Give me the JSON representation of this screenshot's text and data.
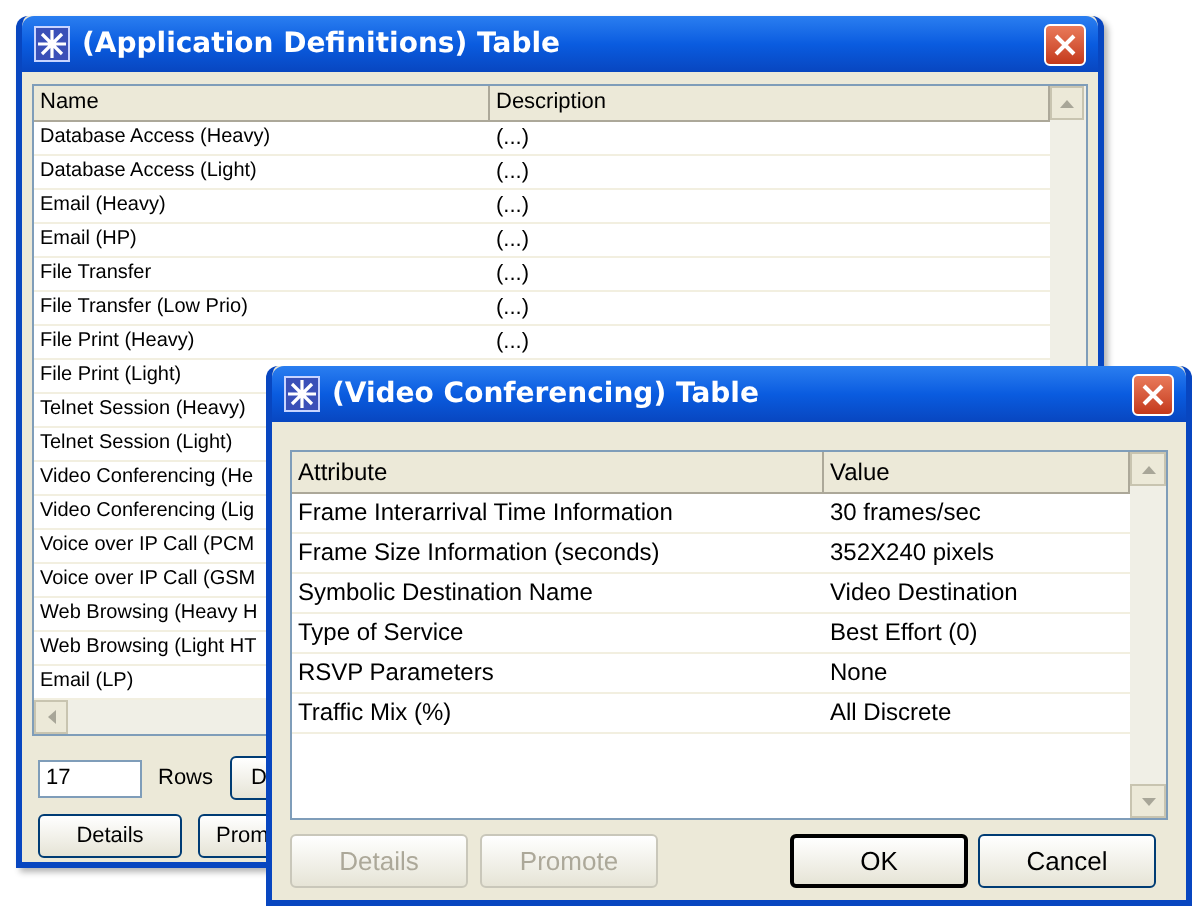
{
  "app_window": {
    "title": "(Application Definitions) Table",
    "columns": [
      "Name",
      "Description"
    ],
    "rows": [
      {
        "name": "Database Access (Heavy)",
        "description": "(...)"
      },
      {
        "name": "Database Access (Light)",
        "description": "(...)"
      },
      {
        "name": "Email (Heavy)",
        "description": "(...)"
      },
      {
        "name": "Email (HP)",
        "description": "(...)"
      },
      {
        "name": "File Transfer",
        "description": "(...)"
      },
      {
        "name": "File Transfer (Low Prio)",
        "description": "(...)"
      },
      {
        "name": "File Print (Heavy)",
        "description": "(...)"
      },
      {
        "name": "File Print (Light)"
      },
      {
        "name": "Telnet Session (Heavy)"
      },
      {
        "name": "Telnet Session (Light)"
      },
      {
        "name": "Video Conferencing (He"
      },
      {
        "name": "Video Conferencing (Lig"
      },
      {
        "name": "Voice over IP Call (PCM"
      },
      {
        "name": "Voice over IP Call (GSM"
      },
      {
        "name": "Web Browsing (Heavy H"
      },
      {
        "name": "Web Browsing (Light HT"
      },
      {
        "name": "Email (LP)"
      }
    ],
    "row_count": "17",
    "row_count_label": "Rows",
    "side_button": "D",
    "buttons": [
      "Details",
      "Prom"
    ]
  },
  "video_window": {
    "title": "(Video Conferencing) Table",
    "columns": [
      "Attribute",
      "Value"
    ],
    "rows": [
      {
        "attribute": "Frame Interarrival Time Information",
        "value": "30 frames/sec"
      },
      {
        "attribute": "Frame Size Information (seconds)",
        "value": "352X240 pixels"
      },
      {
        "attribute": "Symbolic Destination Name",
        "value": "Video Destination"
      },
      {
        "attribute": "Type of Service",
        "value": "Best Effort (0)"
      },
      {
        "attribute": "RSVP Parameters",
        "value": "None"
      },
      {
        "attribute": "Traffic Mix (%)",
        "value": "All Discrete"
      }
    ],
    "buttons": [
      {
        "label": "Details",
        "disabled": true,
        "default": false
      },
      {
        "label": "Promote",
        "disabled": true,
        "default": false
      },
      {
        "label": "OK",
        "disabled": false,
        "default": true
      },
      {
        "label": "Cancel",
        "disabled": false,
        "default": false
      }
    ]
  }
}
